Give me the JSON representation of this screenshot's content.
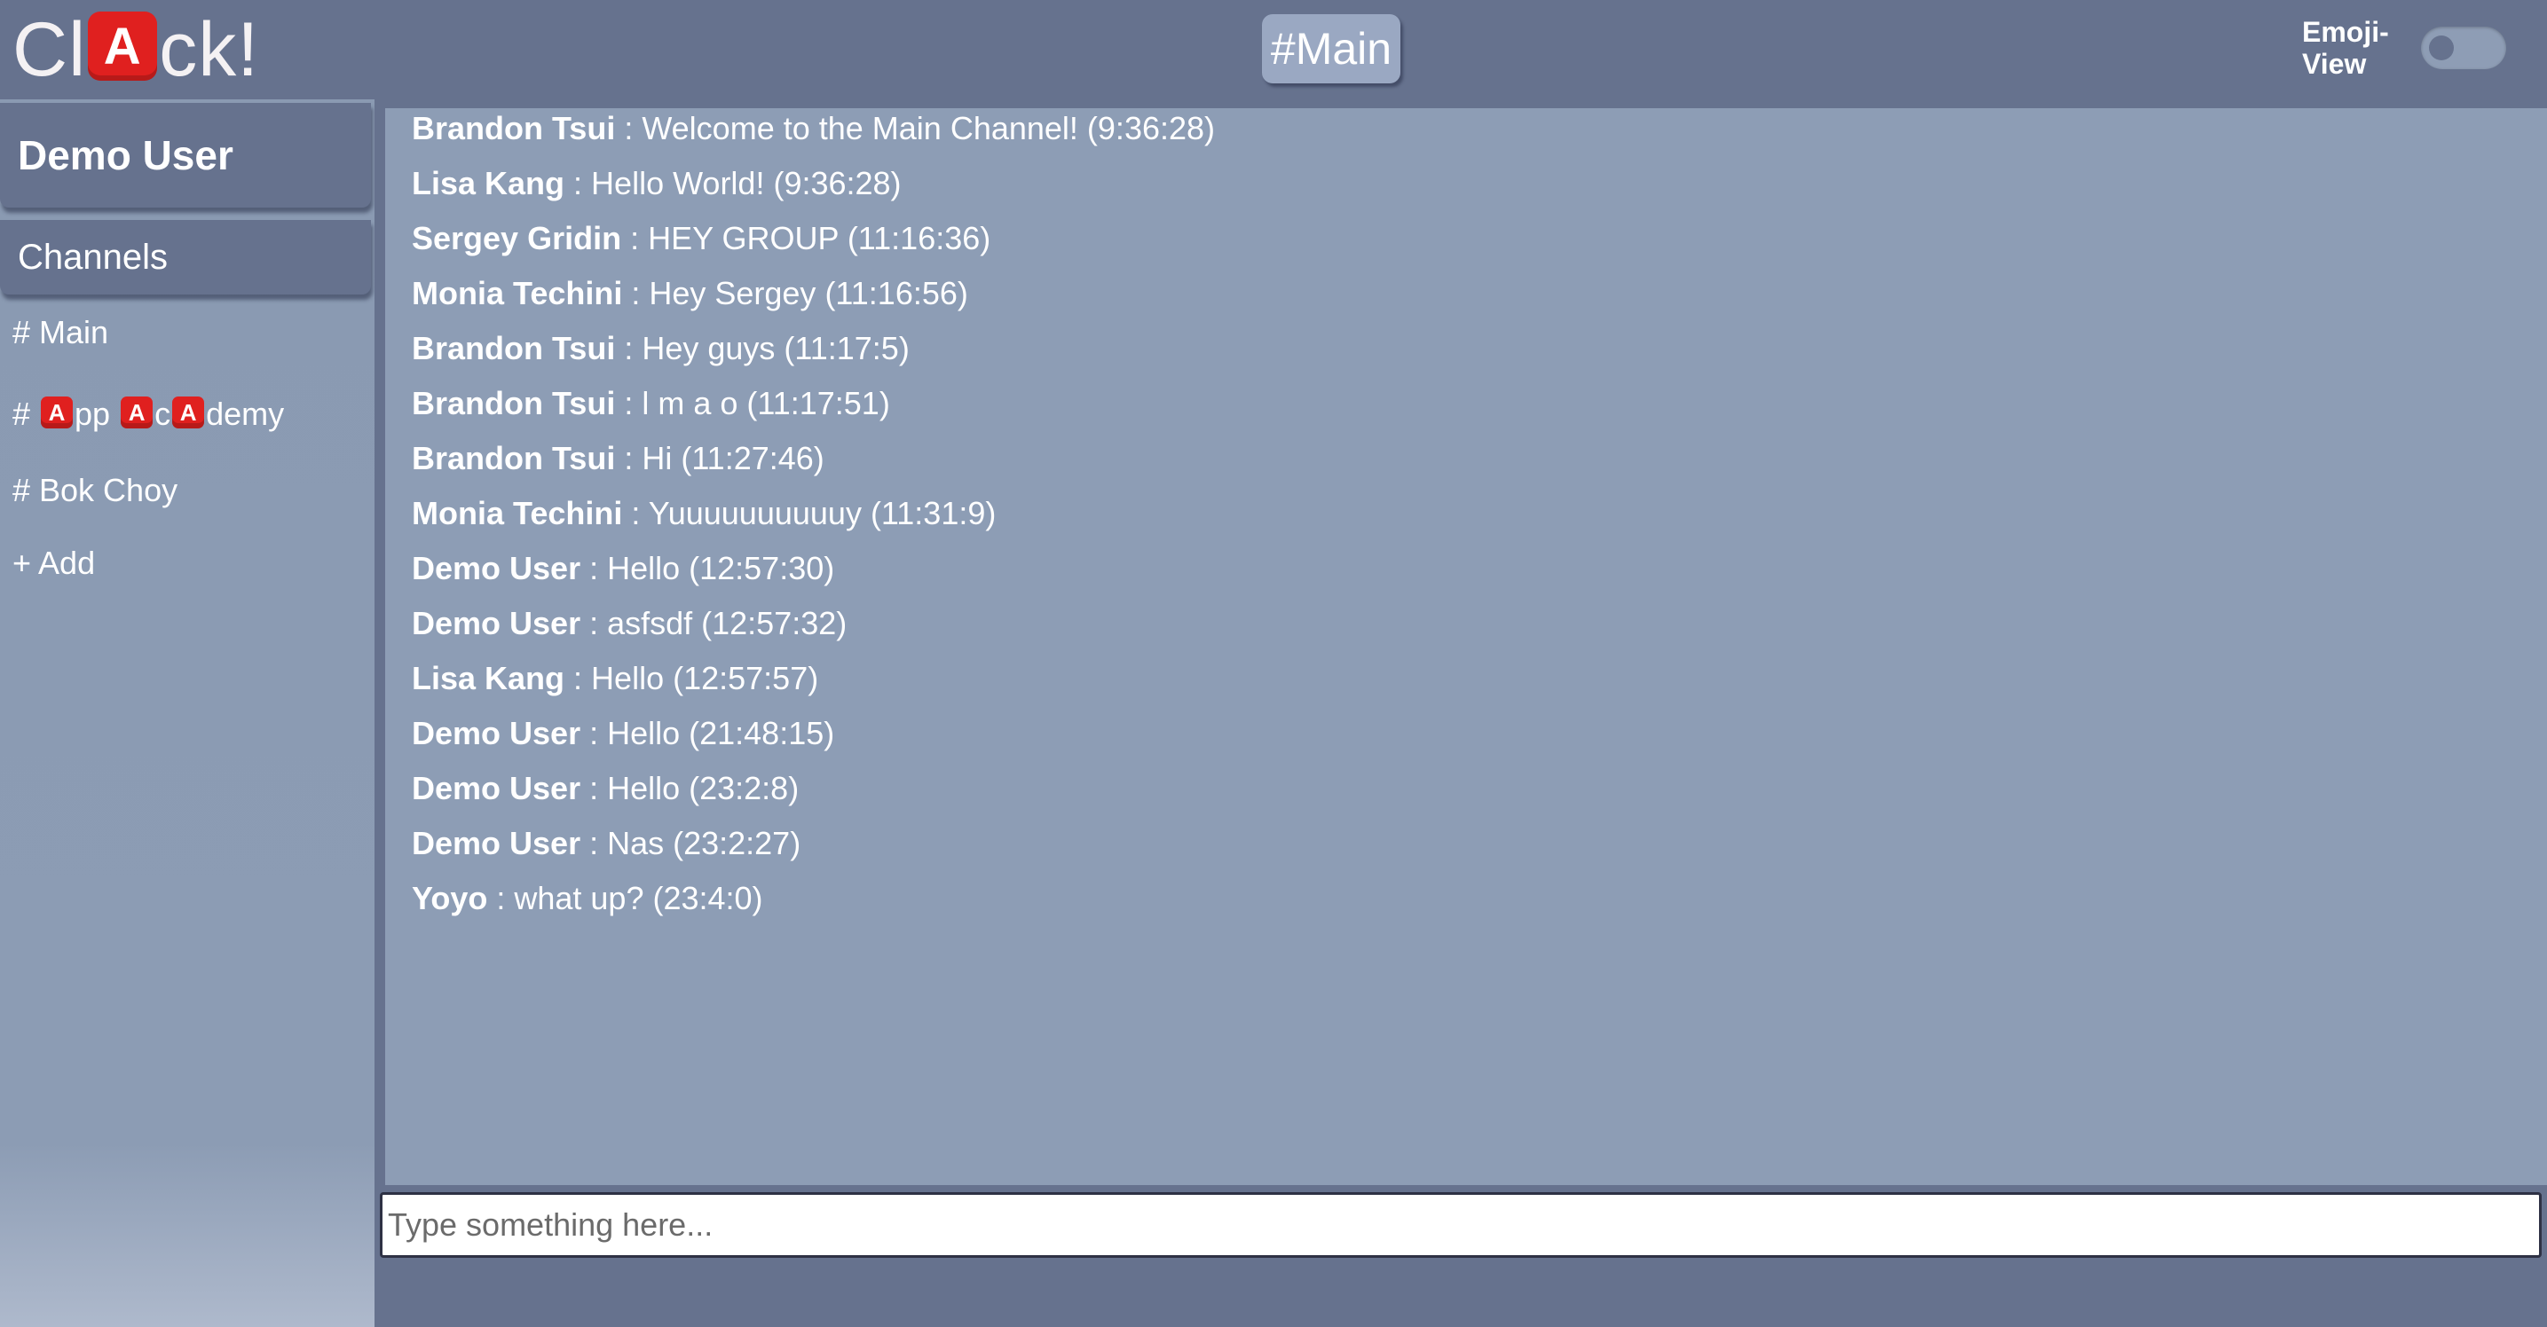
{
  "app": {
    "logo_prefix": "Cl",
    "logo_badge": "A",
    "logo_suffix": "ck!"
  },
  "header": {
    "current_channel": "#Main",
    "emoji_view_label_line1": "Emoji-",
    "emoji_view_label_line2": "View",
    "emoji_view_enabled": false
  },
  "sidebar": {
    "user_name": "Demo User",
    "channels_label": "Channels",
    "channels": [
      {
        "label": "# Main"
      },
      {
        "prefix": "# ",
        "badge1": "A",
        "part1": "pp ",
        "badge2": "A",
        "part2": "c",
        "badge3": "A",
        "part3": "demy"
      },
      {
        "label": "# Bok Choy"
      }
    ],
    "add_label": "+ Add"
  },
  "messages": [
    {
      "author": "Brandon Tsui",
      "text": " : Welcome to the Main Channel! (9:36:28)"
    },
    {
      "author": "Lisa Kang",
      "text": " : Hello World! (9:36:28)"
    },
    {
      "author": "Sergey Gridin",
      "text": " : HEY GROUP (11:16:36)"
    },
    {
      "author": "Monia Techini",
      "text": " : Hey Sergey (11:16:56)"
    },
    {
      "author": "Brandon Tsui",
      "text": " : Hey guys (11:17:5)"
    },
    {
      "author": "Brandon Tsui",
      "text": " : l m a o (11:17:51)"
    },
    {
      "author": "Brandon Tsui",
      "text": " : Hi (11:27:46)"
    },
    {
      "author": "Monia Techini",
      "text": " : Yuuuuuuuuuuy (11:31:9)"
    },
    {
      "author": "Demo User",
      "text": " : Hello (12:57:30)"
    },
    {
      "author": "Demo User",
      "text": " : asfsdf (12:57:32)"
    },
    {
      "author": "Lisa Kang",
      "text": " : Hello (12:57:57)"
    },
    {
      "author": "Demo User",
      "text": " : Hello (21:48:15)"
    },
    {
      "author": "Demo User",
      "text": " : Hello (23:2:8)"
    },
    {
      "author": "Demo User",
      "text": " : Nas (23:2:27)"
    },
    {
      "author": "Yoyo",
      "text": " : what up? (23:4:0)"
    }
  ],
  "composer": {
    "value": "",
    "placeholder": "Type something here..."
  },
  "colors": {
    "header_bg": "#66728e",
    "panel_bg": "#8d9db5",
    "badge_red": "#e0201f"
  }
}
